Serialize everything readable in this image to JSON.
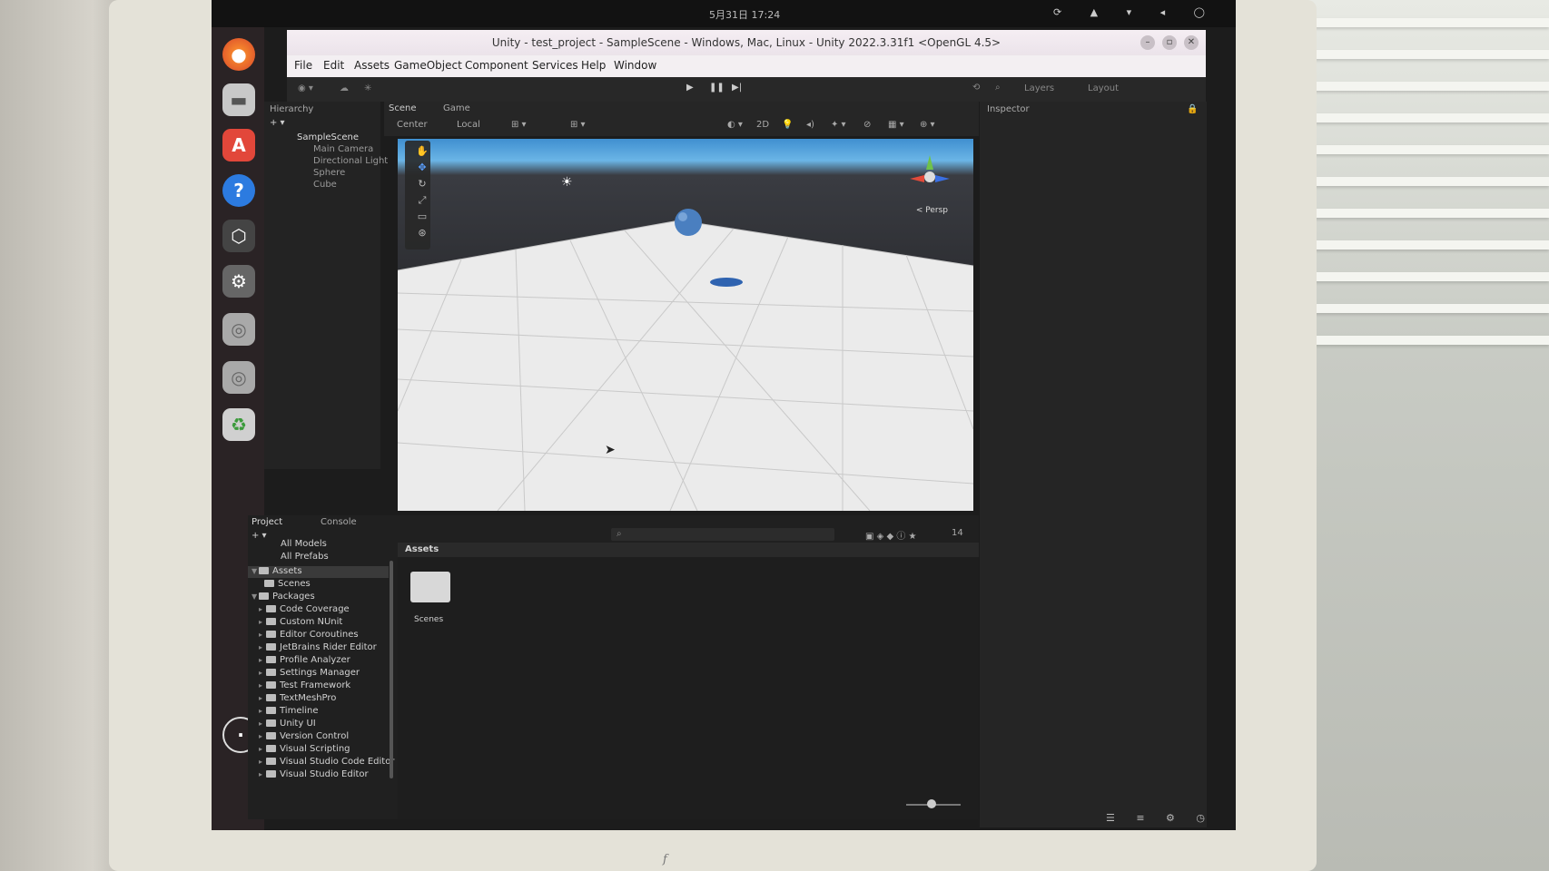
{
  "system": {
    "clock": "5月31日 17:24"
  },
  "window": {
    "title": "Unity - test_project - SampleScene - Windows, Mac, Linux - Unity 2022.3.31f1 <OpenGL 4.5>"
  },
  "menu": [
    "File",
    "Edit",
    "Assets",
    "GameObject",
    "Component",
    "Services",
    "Help",
    "Window"
  ],
  "toolbar": {
    "layers_label": "Layers",
    "layout_label": "Layout"
  },
  "hierarchy": {
    "tab_label": "Hierarchy",
    "scene_name": "SampleScene",
    "objects": [
      "Main Camera",
      "Directional Light",
      "Sphere",
      "Cube"
    ]
  },
  "scene_tabs": {
    "scene": "Scene",
    "game": "Game"
  },
  "scene_toolbar": {
    "pivot_label": "Center",
    "space_label": "Local",
    "mode_2d": "2D",
    "view_label": "< Persp"
  },
  "inspector": {
    "tab_label": "Inspector"
  },
  "project": {
    "tab_label": "Project",
    "console_label": "Console",
    "search_filters": [
      "All Models",
      "All Prefabs"
    ],
    "tree": [
      {
        "label": "Assets",
        "level": 0,
        "expanded": true,
        "selected": true
      },
      {
        "label": "Scenes",
        "level": 1
      },
      {
        "label": "Packages",
        "level": 0,
        "expanded": true
      },
      {
        "label": "Code Coverage",
        "level": 1
      },
      {
        "label": "Custom NUnit",
        "level": 1
      },
      {
        "label": "Editor Coroutines",
        "level": 1
      },
      {
        "label": "JetBrains Rider Editor",
        "level": 1
      },
      {
        "label": "Profile Analyzer",
        "level": 1
      },
      {
        "label": "Settings Manager",
        "level": 1
      },
      {
        "label": "Test Framework",
        "level": 1
      },
      {
        "label": "TextMeshPro",
        "level": 1
      },
      {
        "label": "Timeline",
        "level": 1
      },
      {
        "label": "Unity UI",
        "level": 1
      },
      {
        "label": "Version Control",
        "level": 1
      },
      {
        "label": "Visual Scripting",
        "level": 1
      },
      {
        "label": "Visual Studio Code Editor",
        "level": 1
      },
      {
        "label": "Visual Studio Editor",
        "level": 1
      }
    ],
    "breadcrumb": "Assets",
    "assets": [
      {
        "label": "Scenes",
        "icon": "folder-icon"
      }
    ],
    "hidden_count": "14"
  },
  "colors": {
    "sky_top": "#3f8fd0",
    "floor": "#e9e9e9",
    "sphere": "#4a7fc0",
    "editor_bg": "#232323"
  }
}
